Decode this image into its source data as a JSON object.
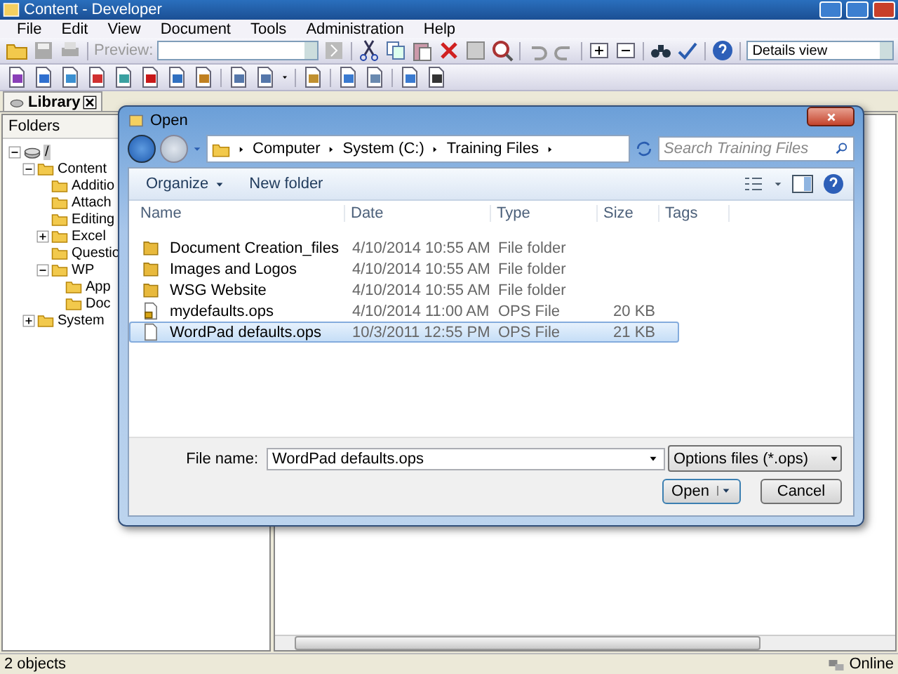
{
  "window": {
    "title": "Content - Developer"
  },
  "menu": [
    "File",
    "Edit",
    "View",
    "Document",
    "Tools",
    "Administration",
    "Help"
  ],
  "toolbar": {
    "preview": {
      "label": "Preview:",
      "disabled": true
    },
    "view_combo": "Details view"
  },
  "tabs": [
    {
      "label": "Library",
      "selected": true
    }
  ],
  "folders": {
    "header": "Folders",
    "tree": [
      {
        "label": "/",
        "kind": "branch",
        "expanded": true,
        "selected": true,
        "children": [
          {
            "label": "Content",
            "kind": "branch",
            "expanded": true,
            "selected": false,
            "children": [
              {
                "label": "Additio",
                "kind": "leaf",
                "selected": false
              },
              {
                "label": "Attach",
                "kind": "leaf",
                "selected": false
              },
              {
                "label": "Editing",
                "kind": "leaf",
                "selected": false
              },
              {
                "label": "Excel",
                "kind": "branch",
                "expanded": false,
                "selected": false
              },
              {
                "label": "Questio",
                "kind": "leaf",
                "selected": false
              },
              {
                "label": "WP",
                "kind": "branch",
                "expanded": true,
                "selected": false,
                "children": [
                  {
                    "label": "App",
                    "kind": "leaf",
                    "selected": false
                  },
                  {
                    "label": "Doc",
                    "kind": "leaf",
                    "selected": false
                  }
                ]
              }
            ]
          },
          {
            "label": "System",
            "kind": "branch",
            "expanded": false,
            "selected": false
          }
        ]
      }
    ]
  },
  "status_bar": {
    "count": "2 objects",
    "connection": "Online"
  },
  "dialog": {
    "title": "Open",
    "breadcrumb": [
      "Computer",
      "System (C:)",
      "Training Files"
    ],
    "search": {
      "placeholder": "Search Training Files"
    },
    "commands": [
      {
        "label": "Organize",
        "dropdown": true
      },
      {
        "label": "New folder",
        "dropdown": false
      }
    ],
    "columns": [
      "Name",
      "Date",
      "Type",
      "Size",
      "Tags"
    ],
    "rows": [
      {
        "kind": "folder",
        "name": "Document Creation_files",
        "date": "4/10/2014 10:55 AM",
        "type": "File folder",
        "size": "",
        "selected": false
      },
      {
        "kind": "folder",
        "name": "Images and Logos",
        "date": "4/10/2014 10:55 AM",
        "type": "File folder",
        "size": "",
        "selected": false
      },
      {
        "kind": "folder",
        "name": "WSG Website",
        "date": "4/10/2014 10:55 AM",
        "type": "File folder",
        "size": "",
        "selected": false
      },
      {
        "kind": "locked-file",
        "name": "mydefaults.ops",
        "date": "4/10/2014 11:00 AM",
        "type": "OPS File",
        "size": "20 KB",
        "selected": false
      },
      {
        "kind": "file",
        "name": "WordPad defaults.ops",
        "date": "10/3/2011 12:55 PM",
        "type": "OPS File",
        "size": "21 KB",
        "selected": true
      }
    ],
    "file_name": {
      "label": "File name:",
      "value": "WordPad defaults.ops"
    },
    "filter": "Options files (*.ops)",
    "buttons": [
      {
        "label": "Open",
        "kind": "split"
      },
      {
        "label": "Cancel",
        "kind": "plain"
      }
    ]
  }
}
